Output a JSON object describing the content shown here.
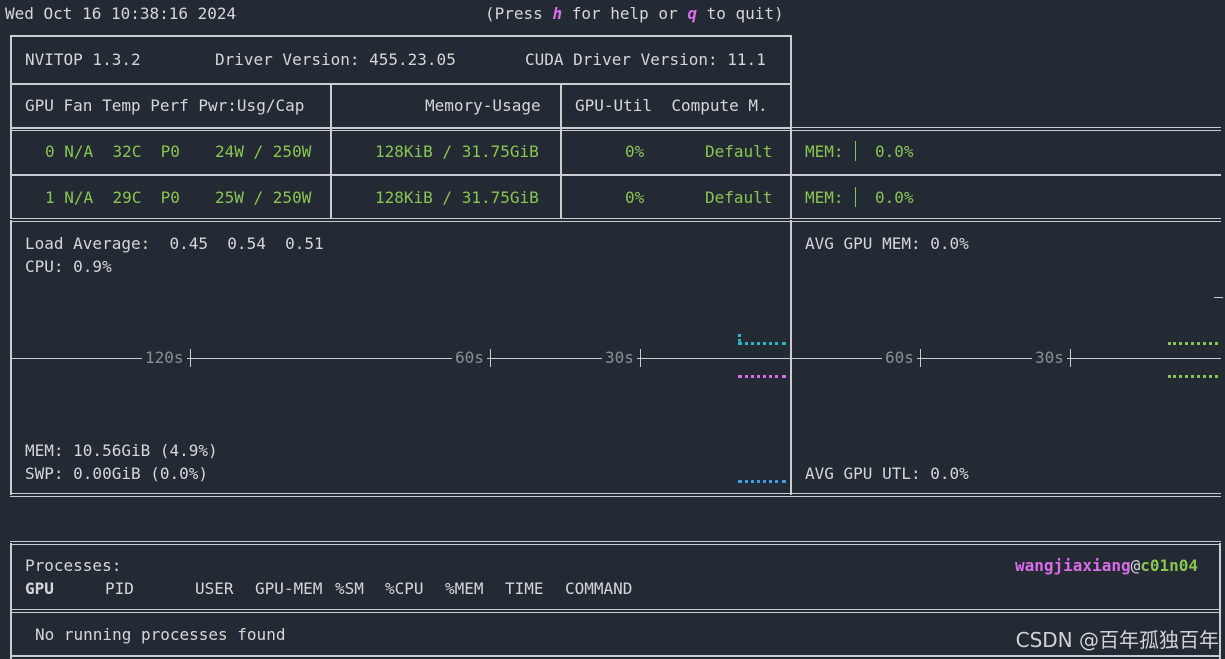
{
  "header": {
    "datetime": "Wed Oct 16 10:38:16 2024",
    "help_prefix": "(Press ",
    "help_key": "h",
    "help_mid": " for help or ",
    "quit_key": "q",
    "help_suffix": " to quit)"
  },
  "version_bar": {
    "nvitop": "NVITOP 1.3.2",
    "driver": "Driver Version: 455.23.05",
    "cuda": "CUDA Driver Version: 11.1"
  },
  "gpu_table": {
    "headers": {
      "col1": "GPU Fan Temp Perf Pwr:Usg/Cap",
      "col2": "Memory-Usage",
      "col3": "GPU-Util  Compute M."
    },
    "rows": [
      {
        "id": "0",
        "fan": "N/A",
        "temp": "32C",
        "perf": "P0",
        "power": "24W / 250W",
        "memory": "128KiB / 31.75GiB",
        "util": "0%",
        "compute": "Default",
        "mem_label": "MEM:",
        "mem_pct": "0.0%"
      },
      {
        "id": "1",
        "fan": "N/A",
        "temp": "29C",
        "perf": "P0",
        "power": "25W / 250W",
        "memory": "128KiB / 31.75GiB",
        "util": "0%",
        "compute": "Default",
        "mem_label": "MEM:",
        "mem_pct": "0.0%"
      }
    ]
  },
  "host_panel": {
    "load_average_label": "Load Average:",
    "load_average": [
      "0.45",
      "0.54",
      "0.51"
    ],
    "cpu": "CPU: 0.9%",
    "mem": "MEM: 10.56GiB (4.9%)",
    "swp": "SWP: 0.00GiB (0.0%)",
    "time_labels": [
      "120s",
      "60s",
      "30s"
    ]
  },
  "gpu_panel": {
    "avg_mem": "AVG GPU MEM: 0.0%",
    "avg_util": "AVG GPU UTL: 0.0%",
    "time_labels": [
      "60s",
      "30s"
    ]
  },
  "processes": {
    "title": "Processes:",
    "user": "wangjiaxiang",
    "at": "@",
    "host": "c01n04",
    "columns": [
      "GPU",
      "PID",
      "USER",
      "GPU-MEM",
      "%SM",
      "%CPU",
      "%MEM",
      "TIME",
      "COMMAND"
    ],
    "empty_message": "No running processes found"
  },
  "watermark": "CSDN @百年孤独百年",
  "colors": {
    "background": "#242a33",
    "text": "#d4d6d9",
    "green": "#8ac452",
    "magenta": "#d96ce8",
    "cyan": "#2ab7c9",
    "blue": "#3d9ee8"
  }
}
